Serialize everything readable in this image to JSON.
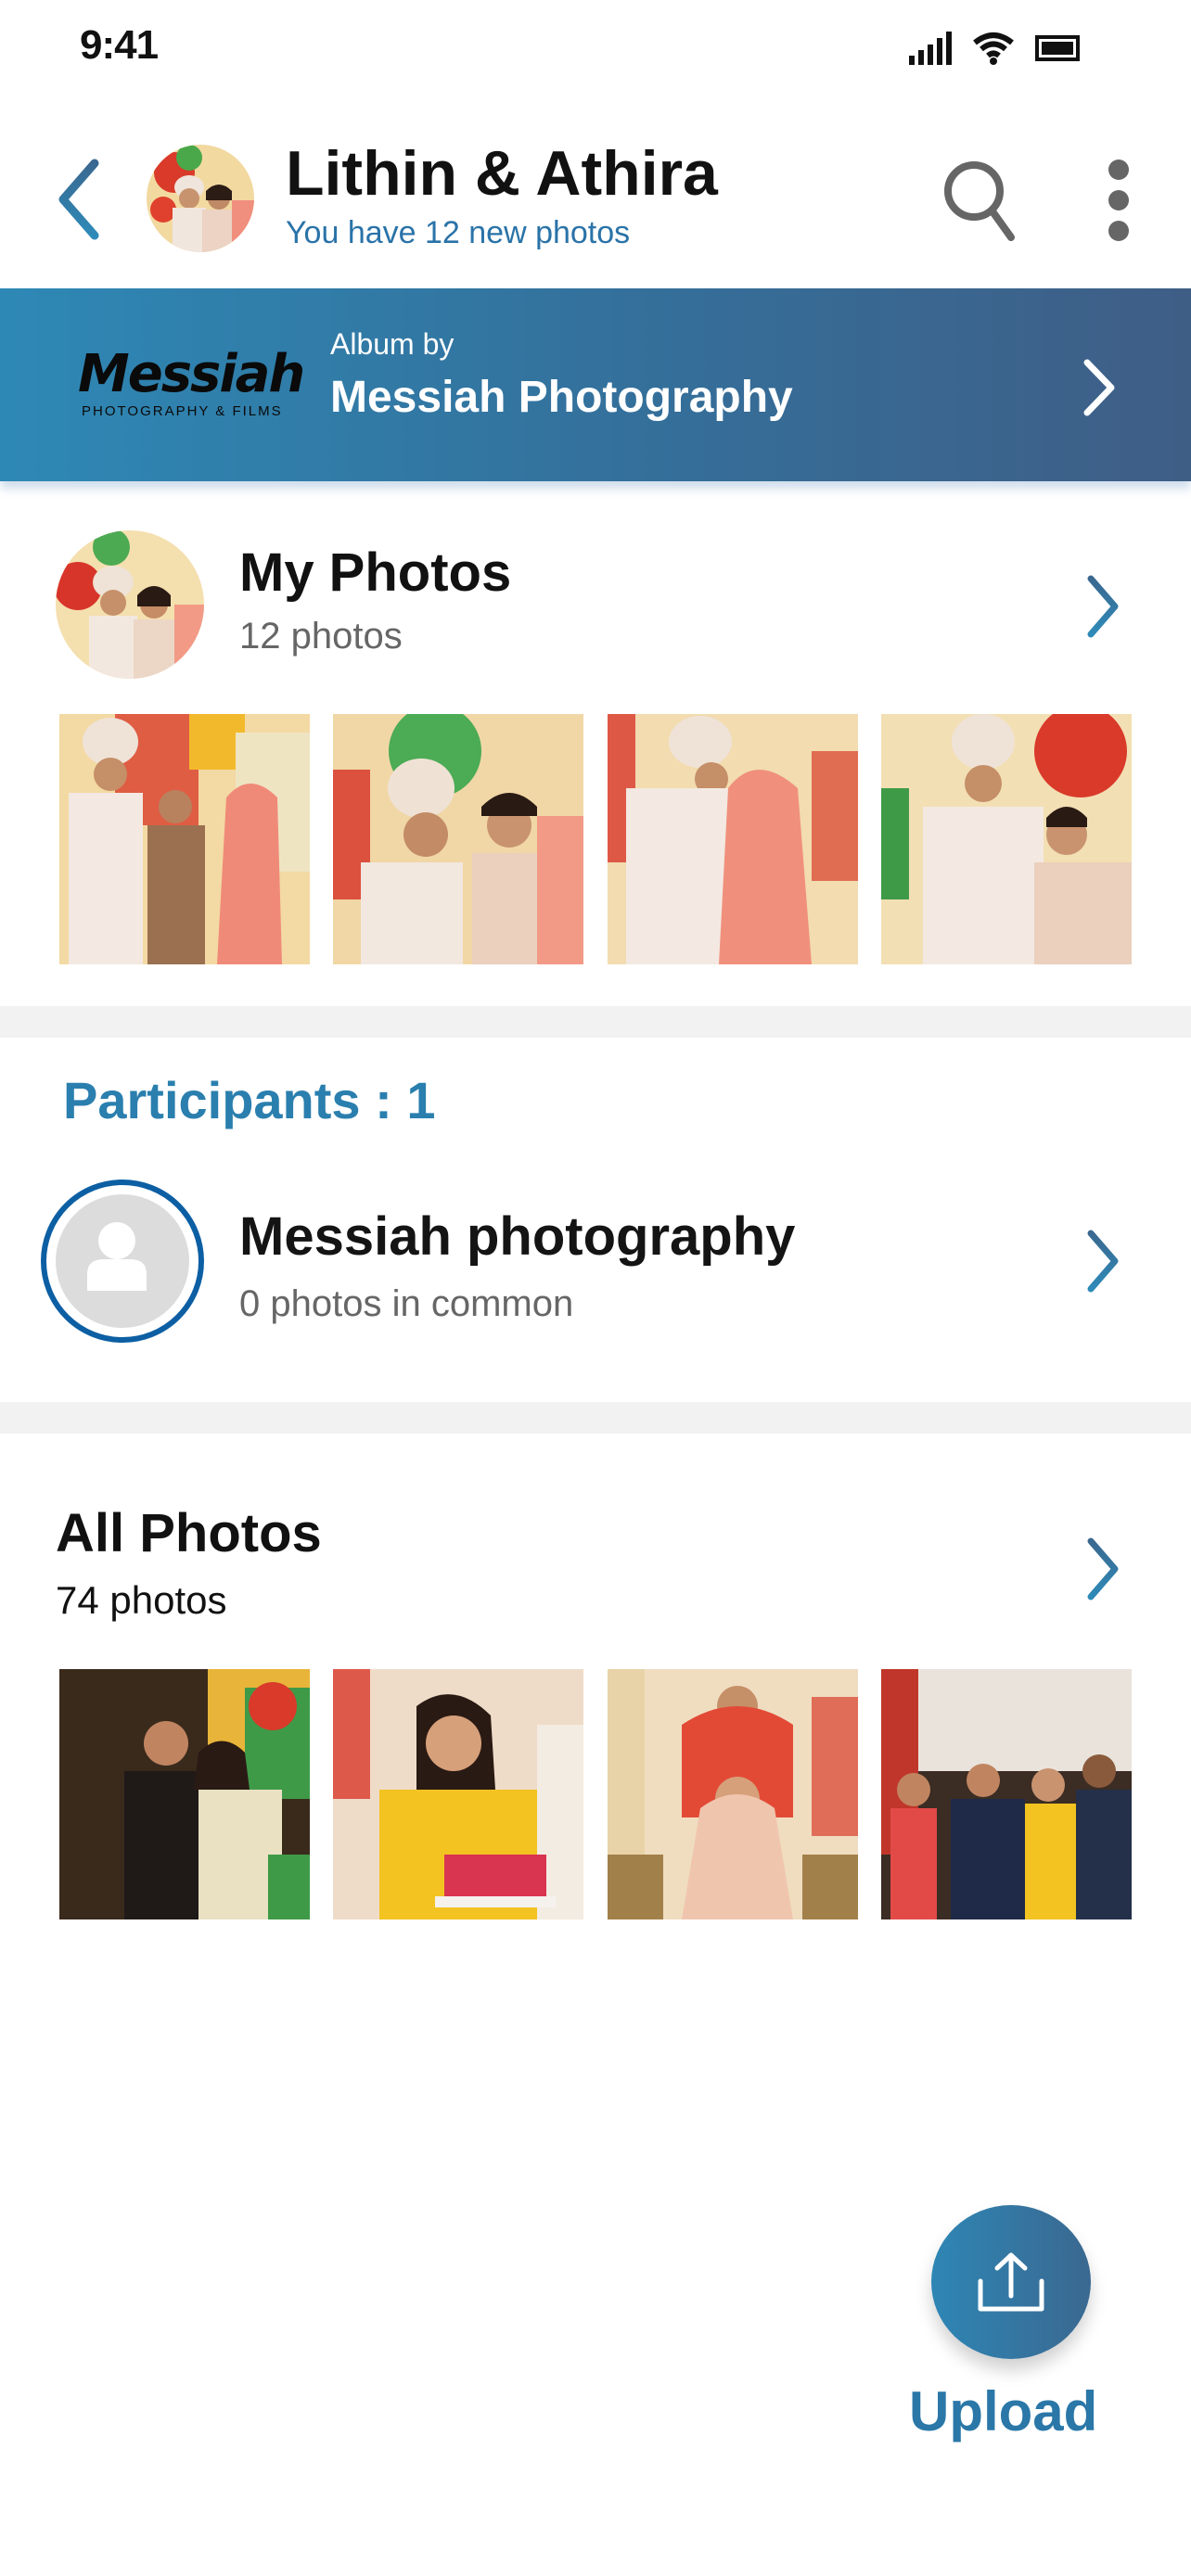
{
  "status_bar": {
    "time": "9:41",
    "icons": [
      "cellular-signal-icon",
      "wifi-icon",
      "battery-icon"
    ]
  },
  "header": {
    "title": "Lithin & Athira",
    "subtitle": "You have 12 new photos",
    "back_icon": "chevron-left-icon",
    "search_icon": "search-icon",
    "more_icon": "more-vertical-icon"
  },
  "album_banner": {
    "logo_text": "Messiah",
    "logo_subtext": "PHOTOGRAPHY & FILMS",
    "label": "Album by",
    "name": "Messiah Photography"
  },
  "my_photos": {
    "title": "My Photos",
    "count": "12 photos",
    "thumbnails": [
      {
        "description": "groom, boy in brown suit and bride posing"
      },
      {
        "description": "groom and bride seated smiling"
      },
      {
        "description": "groom and bride facing each other"
      },
      {
        "description": "groom and bride standing"
      }
    ]
  },
  "participants": {
    "title": "Participants : 1",
    "items": [
      {
        "name": "Messiah photography",
        "subtitle": "0 photos in common"
      }
    ]
  },
  "all_photos": {
    "title": "All Photos",
    "count": "74 photos",
    "thumbnails": [
      {
        "description": "couple in black suit and cream saree"
      },
      {
        "description": "woman in yellow holding flower tray"
      },
      {
        "description": "bride seated with woman behind her"
      },
      {
        "description": "group of guests posing"
      }
    ]
  },
  "upload": {
    "label": "Upload",
    "icon": "upload-icon"
  },
  "colors": {
    "accent": "#2a7fae",
    "banner_start": "#2e88b5",
    "banner_end": "#3f5e86",
    "participant_ring": "#0d5fa3",
    "divider": "#f2f2f2"
  }
}
